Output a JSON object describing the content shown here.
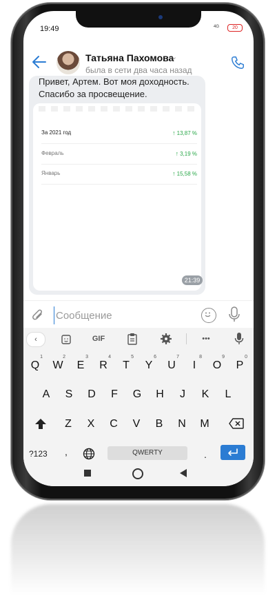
{
  "status_bar": {
    "time": "19:49",
    "signal": "4G",
    "battery": "20"
  },
  "header": {
    "contact_name": "Татьяна Пахомова",
    "last_seen": "была в сети два часа назад"
  },
  "message": {
    "text": "Привет, Артем. Вот моя доходность. Спасибо за просвещение.",
    "time": "21:39",
    "card_rows": [
      {
        "label": "За 2021 год",
        "value": "13,87 %"
      },
      {
        "label": "Февраль",
        "value": "3,19 %"
      },
      {
        "label": "Январь",
        "value": "15,58 %"
      }
    ]
  },
  "input": {
    "placeholder": "Сообщение"
  },
  "keyboard": {
    "toolbar": {
      "gif_label": "GIF",
      "more_label": "•••"
    },
    "row1": [
      {
        "k": "Q",
        "s": "1"
      },
      {
        "k": "W",
        "s": "2"
      },
      {
        "k": "E",
        "s": "3"
      },
      {
        "k": "R",
        "s": "4"
      },
      {
        "k": "T",
        "s": "5"
      },
      {
        "k": "Y",
        "s": "6"
      },
      {
        "k": "U",
        "s": "7"
      },
      {
        "k": "I",
        "s": "8"
      },
      {
        "k": "O",
        "s": "9"
      },
      {
        "k": "P",
        "s": "0"
      }
    ],
    "row2": [
      "A",
      "S",
      "D",
      "F",
      "G",
      "H",
      "J",
      "K",
      "L"
    ],
    "row3": [
      "Z",
      "X",
      "C",
      "V",
      "B",
      "N",
      "M"
    ],
    "symbols_label": "?123",
    "comma_label": ",",
    "period_label": ".",
    "space_label": "QWERTY"
  },
  "colors": {
    "accent": "#2b7cd3",
    "positive": "#2ba84a",
    "bubble": "#eceef1"
  }
}
